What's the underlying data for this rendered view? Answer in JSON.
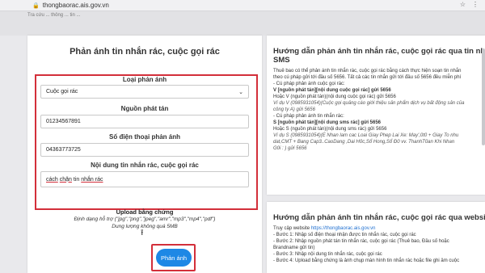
{
  "browser": {
    "url": "thongbaorac.ais.gov.vn",
    "subbar_text": "Tra cứu ... thông ... tin ..."
  },
  "form": {
    "title": "Phản ánh tin nhắn rác, cuộc gọi rác",
    "type_label": "Loại phản ánh",
    "type_value": "Cuộc gọi rác",
    "source_label": "Nguồn phát tán",
    "source_value": "01234567891",
    "phone_label": "Số điện thoại phản ánh",
    "phone_value": "04363773725",
    "content_label": "Nội dung tin nhắn rác, cuộc gọi rác",
    "content_w1": "cách",
    "content_w2": "chặn",
    "content_w3": " tin ",
    "content_w4": "nhắn rác",
    "upload_label": "Upload bằng chứng",
    "upload_formats": "Định dạng hỗ trợ (\"jpg\",\"png\",\"jpeg\",\"amr\",\"mp3\",\"mp4\",\"pdf\")",
    "upload_size": "Dung lượng không quá 5MB",
    "submit_label": "Phản ánh"
  },
  "guide_sms": {
    "title1": "Hướng dẫn phản ánh tin nhắn rác, cuộc gọi rác qua tin nhắn",
    "title2": "SMS",
    "lines": [
      "Thuê bao có thể phản ánh tin nhắn rác, cuộc gọi rác bằng cách thực hiện soạn tin nhắn",
      "theo cú pháp gửi tới đầu số 5656. Tất cả các tin nhắn gửi tới đầu số 5656 đều miễn phí",
      "- Cú pháp phản ánh cuộc gọi rác:",
      "V [nguồn phát tán][nội dung cuộc gọi rác] gửi 5656",
      "Hoặc V (nguồn phát tán)(nội dung cuộc gọi rác) gửi 5656",
      "Ví dụ V (0985931054)(Cuộc gọi quảng cáo giới thiệu sản phẩm dịch vụ bất động sản của",
      "công ty A) gửi 5656",
      "- Cú pháp phản ánh tin nhắn rác:",
      "S [nguồn phát tán][nội dung sms rác] gửi 5656",
      "Hoặc S (nguồn phát tán)(nội dung sms rác) gửi 5656",
      "Ví dụ S (0985931054)(E Nhan lam cac Loai Giay Phep Lai Xe: May',0t0 + Giay To nhu",
      "dat,CMT + Bang Cap3..CaoDang ,Dai H0c,Sổ Hong,Sổ Đ0 vv. ThanhT0an Khi Nhan",
      "G0i : ) gửi 5656"
    ]
  },
  "guide_web": {
    "title": "Hướng dẫn phản ánh tin nhắn rác, cuộc gọi rác qua website",
    "access_prefix": "Truy cập website ",
    "access_link": "https://thongbaorac.ais.gov.vn",
    "steps": [
      "- Bước 1: Nhập số điện thoại nhận được tin nhắn rác, cuộc gọi rác",
      "- Bước 2: Nhập nguồn phát tán tin nhắn rác, cuộc gọi rác (Thuê bao, Đầu số hoặc",
      "Brandname gửi tin)",
      "- Bước 3: Nhập nội dung tin nhắn rác, cuộc gọi rác",
      "- Bước 4: Upload bằng chứng là ảnh chụp màn hình tin nhắn rác hoặc file ghi âm cuộc"
    ]
  },
  "colors": {
    "highlight": "#d32f3a",
    "button": "#1e88e5",
    "link": "#1e6fd0"
  }
}
